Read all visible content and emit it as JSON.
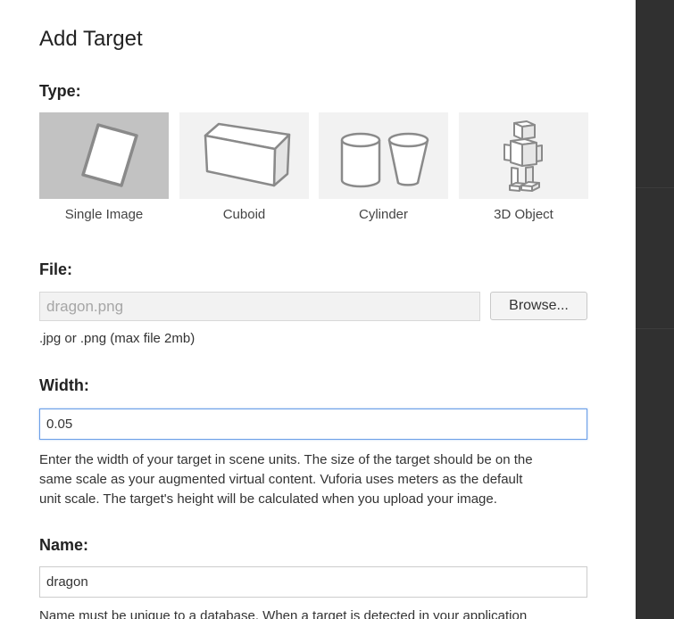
{
  "dialog": {
    "title": "Add Target"
  },
  "type": {
    "label": "Type:",
    "options": [
      {
        "label": "Single Image",
        "icon": "single-image-icon",
        "selected": true
      },
      {
        "label": "Cuboid",
        "icon": "cuboid-icon",
        "selected": false
      },
      {
        "label": "Cylinder",
        "icon": "cylinder-icon",
        "selected": false
      },
      {
        "label": "3D Object",
        "icon": "3d-object-icon",
        "selected": false
      }
    ]
  },
  "file": {
    "label": "File:",
    "value": "dragon.png",
    "browse_label": "Browse...",
    "hint": ".jpg or .png (max file 2mb)"
  },
  "width": {
    "label": "Width:",
    "value": "0.05",
    "help_lines": [
      "Enter the width of your target in scene units. The size of the target should be on the",
      "same scale as your augmented virtual content. Vuforia uses meters as the default",
      "unit scale. The target's height will be calculated when you upload your image."
    ]
  },
  "name": {
    "label": "Name:",
    "value": "dragon",
    "help": "Name must be unique to a database. When a target is detected in your application"
  },
  "colors": {
    "selected_tile": "#c2c2c2",
    "tile": "#f2f2f2",
    "focus_border": "#6a9ee8",
    "side_panel": "#303030"
  }
}
